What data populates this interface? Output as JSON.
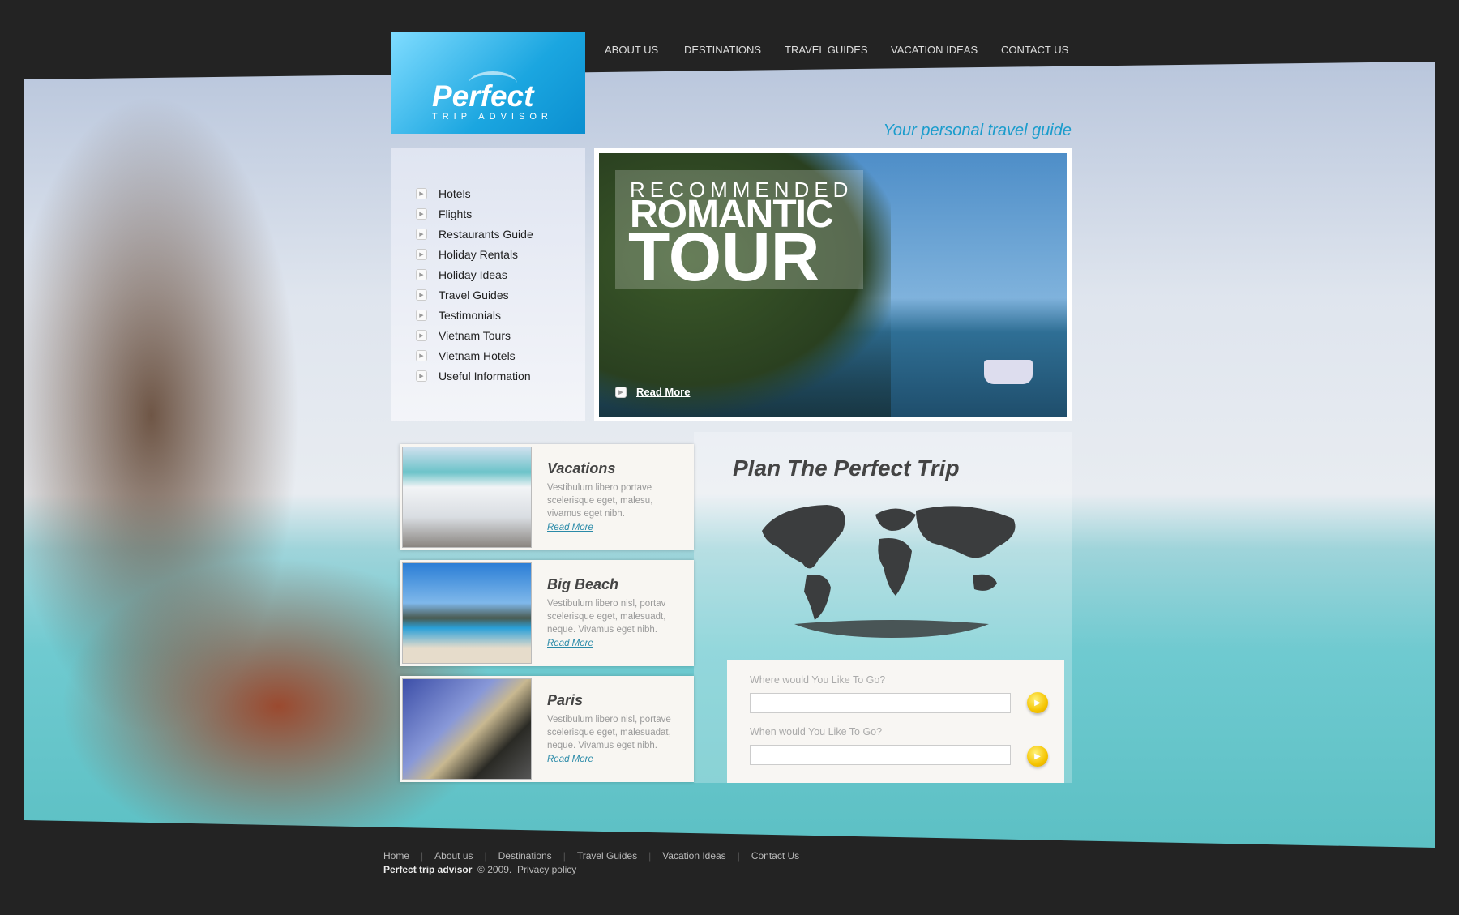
{
  "logo": {
    "title": "Perfect",
    "subtitle": "TRIP ADVISOR"
  },
  "nav": [
    "ABOUT US",
    "DESTINATIONS",
    "TRAVEL GUIDES",
    "VACATION IDEAS",
    "CONTACT US"
  ],
  "tagline": "Your personal travel guide",
  "menu": [
    "Hotels",
    "Flights",
    "Restaurants Guide",
    "Holiday Rentals",
    "Holiday Ideas",
    "Travel Guides",
    "Testimonials",
    "Vietnam Tours",
    "Vietnam Hotels",
    "Useful Information"
  ],
  "hero": {
    "line1": "RECOMMENDED",
    "line2": "ROMANTIC",
    "line3": "TOUR",
    "read_more": "Read More"
  },
  "cards": [
    {
      "title": "Vacations",
      "text": "Vestibulum libero portave scelerisque eget, malesu, vivamus eget nibh.",
      "link": "Read More"
    },
    {
      "title": "Big Beach",
      "text": "Vestibulum libero nisl, portav scelerisque eget, malesuadt, neque. Vivamus eget nibh.",
      "link": "Read More"
    },
    {
      "title": "Paris",
      "text": "Vestibulum libero nisl, portave scelerisque eget, malesuadat, neque. Vivamus eget nibh.",
      "link": "Read More"
    }
  ],
  "plan": {
    "title": "Plan The Perfect Trip",
    "where_label": "Where would You Like To Go?",
    "where_value": "",
    "when_label": "When would You Like To Go?",
    "when_value": ""
  },
  "footer": {
    "links": [
      "Home",
      "About us",
      "Destinations",
      "Travel Guides",
      "Vacation Ideas",
      "Contact Us"
    ],
    "brand": "Perfect trip advisor",
    "copyright": "© 2009.",
    "privacy": "Privacy policy"
  },
  "colors": {
    "accent": "#1a9ccc",
    "background": "#232323",
    "button": "#f5c400"
  }
}
